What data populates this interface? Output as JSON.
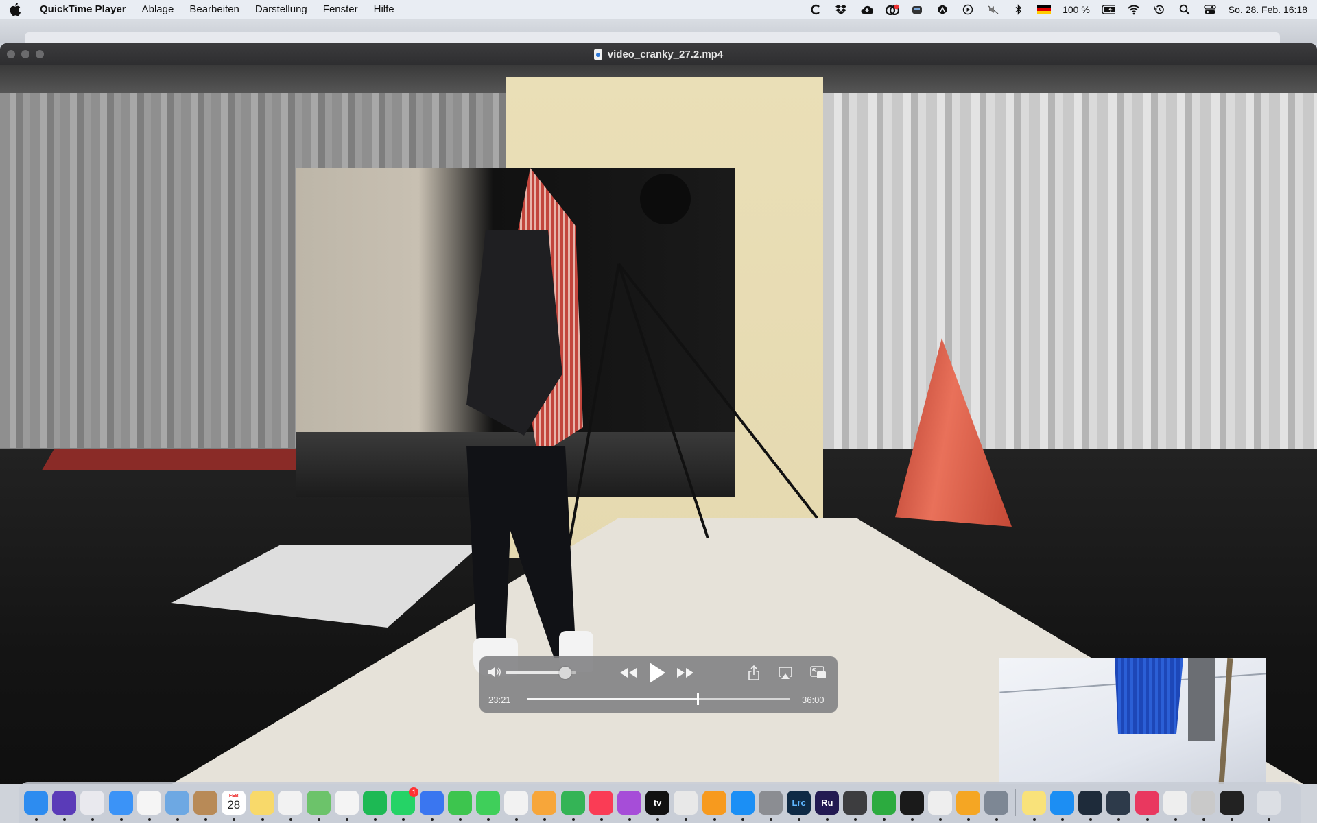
{
  "menubar": {
    "app_name": "QuickTime Player",
    "items": [
      "Ablage",
      "Bearbeiten",
      "Darstellung",
      "Fenster",
      "Hilfe"
    ],
    "status": {
      "battery_label": "100 %",
      "datetime": "So. 28. Feb.  16:18",
      "icons": [
        "c-icon",
        "dropbox-icon",
        "cloud-upload-icon",
        "creative-cloud-icon",
        "vpn-icon",
        "nordvpn-icon",
        "play-circle-icon",
        "muted-icon",
        "bluetooth-icon",
        "german-flag-icon",
        "battery-icon",
        "wifi-icon",
        "time-machine-icon",
        "search-icon",
        "control-center-icon"
      ]
    }
  },
  "window": {
    "title": "video_cranky_27.2.mp4"
  },
  "player": {
    "current_time": "23:21",
    "total_time": "36:00",
    "progress_fraction": 0.6486,
    "volume_fraction": 0.84
  },
  "dock": {
    "calendar_month": "FEB",
    "calendar_day": "28",
    "whatsapp_badge": "1",
    "appletv_label": "tv",
    "lightroom_label": "Lrc",
    "rush_label": "Ru",
    "apps": [
      {
        "name": "finder",
        "color": "#2d8cf0"
      },
      {
        "name": "siri",
        "color": "#5a3bb8"
      },
      {
        "name": "launchpad",
        "color": "#e9e9ee"
      },
      {
        "name": "mail",
        "color": "#3b93f7"
      },
      {
        "name": "chrome",
        "color": "#f5f5f5"
      },
      {
        "name": "preview",
        "color": "#6da8e3"
      },
      {
        "name": "contacts",
        "color": "#b88a57"
      },
      {
        "name": "calendar",
        "color": "#ffffff"
      },
      {
        "name": "notes",
        "color": "#f8d96a"
      },
      {
        "name": "reminders",
        "color": "#f2f2f2"
      },
      {
        "name": "maps",
        "color": "#6cc36a"
      },
      {
        "name": "photos",
        "color": "#f4f4f4"
      },
      {
        "name": "spotify",
        "color": "#1db954"
      },
      {
        "name": "whatsapp",
        "color": "#25d366"
      },
      {
        "name": "signal",
        "color": "#3a76f0"
      },
      {
        "name": "facetime",
        "color": "#3dc54e"
      },
      {
        "name": "messages",
        "color": "#3fcf5a"
      },
      {
        "name": "textedit",
        "color": "#f2f2f2"
      },
      {
        "name": "pages",
        "color": "#f7a63a"
      },
      {
        "name": "numbers",
        "color": "#34b456"
      },
      {
        "name": "music",
        "color": "#fa3c55"
      },
      {
        "name": "podcasts",
        "color": "#a64dd8"
      },
      {
        "name": "apple-tv",
        "color": "#111111"
      },
      {
        "name": "screenshot",
        "color": "#e8e8e8"
      },
      {
        "name": "books",
        "color": "#f79a1e"
      },
      {
        "name": "app-store",
        "color": "#1b8ff5"
      },
      {
        "name": "system-preferences",
        "color": "#8b8d92"
      },
      {
        "name": "lightroom-classic",
        "color": "#0f2a45"
      },
      {
        "name": "premiere-rush",
        "color": "#231a52"
      },
      {
        "name": "calculator",
        "color": "#3d3d3f"
      },
      {
        "name": "pie-chart-app",
        "color": "#2cab3f"
      },
      {
        "name": "activity-ring-app",
        "color": "#1a1a1a"
      },
      {
        "name": "solitaire",
        "color": "#eeeeee"
      },
      {
        "name": "keynote",
        "color": "#f5a623"
      },
      {
        "name": "archive-utility",
        "color": "#7d8794"
      },
      {
        "name": "stickies",
        "color": "#f9e27a"
      },
      {
        "name": "safari",
        "color": "#1c8ef3"
      },
      {
        "name": "prompt",
        "color": "#1e2b3a"
      },
      {
        "name": "quicktime",
        "color": "#2d3a4a"
      },
      {
        "name": "creative-cloud",
        "color": "#e9385f"
      },
      {
        "name": "migration",
        "color": "#eeeeee"
      },
      {
        "name": "disk-utility",
        "color": "#c9c9c9"
      },
      {
        "name": "film-strip",
        "color": "#222222"
      },
      {
        "name": "trash",
        "color": "#dcdfe4"
      }
    ]
  }
}
